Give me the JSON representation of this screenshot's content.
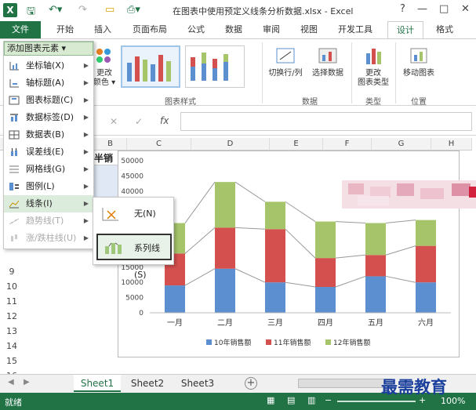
{
  "titlebar": {
    "app_icon": "X",
    "title": "在图表中使用预定义线条分析数据.xlsx - Excel",
    "help": "?",
    "minimize": "—",
    "restore": "□",
    "close": "✕",
    "quick_access": [
      "save-icon",
      "undo-icon",
      "redo-icon",
      "open-icon",
      "print-icon"
    ]
  },
  "tabs": [
    {
      "label": "文件"
    },
    {
      "label": "开始"
    },
    {
      "label": "插入"
    },
    {
      "label": "页面布局"
    },
    {
      "label": "公式"
    },
    {
      "label": "数据"
    },
    {
      "label": "审阅"
    },
    {
      "label": "视图"
    },
    {
      "label": "开发工具"
    },
    {
      "label": "设计"
    },
    {
      "label": "格式"
    }
  ],
  "ribbon": {
    "add_element": "添加图表元素 ▾",
    "change_color_1": "更改",
    "change_color_2": "颜色 ▾",
    "chart_styles_label": "图表样式",
    "switch_row_col": "切换行/列",
    "select_data": "选择数据",
    "data_group_label": "数据",
    "change_type_1": "更改",
    "change_type_2": "图表类型",
    "type_group_label": "类型",
    "move_chart": "移动图表",
    "location_group_label": "位置"
  },
  "formula_bar": {
    "cancel": "✕",
    "enter": "✓",
    "fx": "fx"
  },
  "grid": {
    "col_headers": [
      "B",
      "C",
      "D",
      "E",
      "F",
      "G",
      "H"
    ],
    "row_headers": [
      "9",
      "10",
      "11",
      "12",
      "13",
      "14",
      "15",
      "16",
      "17"
    ],
    "partial_cell": "半销"
  },
  "menu": {
    "items": [
      {
        "label": "坐标轴(X)",
        "state": "normal"
      },
      {
        "label": "轴标题(A)",
        "state": "normal"
      },
      {
        "label": "图表标题(C)",
        "state": "normal"
      },
      {
        "label": "数据标签(D)",
        "state": "normal"
      },
      {
        "label": "数据表(B)",
        "state": "normal"
      },
      {
        "label": "误差线(E)",
        "state": "normal"
      },
      {
        "label": "网格线(G)",
        "state": "normal"
      },
      {
        "label": "图例(L)",
        "state": "normal"
      },
      {
        "label": "线条(I)",
        "state": "highlight"
      },
      {
        "label": "趋势线(T)",
        "state": "disabled"
      },
      {
        "label": "涨/跌柱线(U)",
        "state": "disabled"
      }
    ]
  },
  "submenu": {
    "items": [
      {
        "label": "无(N)"
      },
      {
        "label": "系列线(S)"
      }
    ]
  },
  "chart_data": {
    "type": "bar",
    "stacked": true,
    "categories": [
      "一月",
      "二月",
      "三月",
      "四月",
      "五月",
      "六月"
    ],
    "series": [
      {
        "name": "10年销售额",
        "color": "#5b8fd0",
        "values": [
          9000,
          14500,
          10000,
          8500,
          12000,
          10000
        ]
      },
      {
        "name": "11年销售额",
        "color": "#d4504f",
        "values": [
          10500,
          13500,
          17500,
          9500,
          7000,
          12000
        ]
      },
      {
        "name": "12年销售额",
        "color": "#a6c46a",
        "values": [
          10000,
          15000,
          9000,
          12000,
          10500,
          8500
        ]
      }
    ],
    "yticks": [
      "0",
      "5000",
      "10000",
      "15000",
      "20000",
      "25000",
      "30000",
      "35000",
      "40000",
      "45000",
      "50000"
    ],
    "ylim": [
      0,
      50000
    ],
    "series_lines": true,
    "legend_position": "bottom"
  },
  "sheets": [
    {
      "label": "Sheet1"
    },
    {
      "label": "Sheet2"
    },
    {
      "label": "Sheet3"
    }
  ],
  "status": {
    "ready": "就绪",
    "zoom": "100%"
  },
  "watermark": "最需教育"
}
